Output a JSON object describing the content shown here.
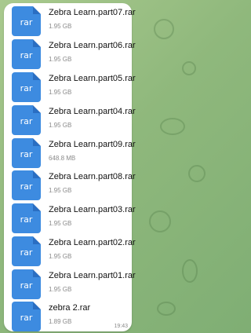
{
  "message": {
    "time": "19:43",
    "files": [
      {
        "name": "Zebra Learn.part07.rar",
        "size": "1.95 GB",
        "ext": "rar"
      },
      {
        "name": "Zebra Learn.part06.rar",
        "size": "1.95 GB",
        "ext": "rar"
      },
      {
        "name": "Zebra Learn.part05.rar",
        "size": "1.95 GB",
        "ext": "rar"
      },
      {
        "name": "Zebra Learn.part04.rar",
        "size": "1.95 GB",
        "ext": "rar"
      },
      {
        "name": "Zebra Learn.part09.rar",
        "size": "648.8 MB",
        "ext": "rar"
      },
      {
        "name": "Zebra Learn.part08.rar",
        "size": "1.95 GB",
        "ext": "rar"
      },
      {
        "name": "Zebra Learn.part03.rar",
        "size": "1.95 GB",
        "ext": "rar"
      },
      {
        "name": "Zebra Learn.part02.rar",
        "size": "1.95 GB",
        "ext": "rar"
      },
      {
        "name": "Zebra Learn.part01.rar",
        "size": "1.95 GB",
        "ext": "rar"
      },
      {
        "name": "zebra 2.rar",
        "size": "1.89 GB",
        "ext": "rar"
      }
    ]
  }
}
